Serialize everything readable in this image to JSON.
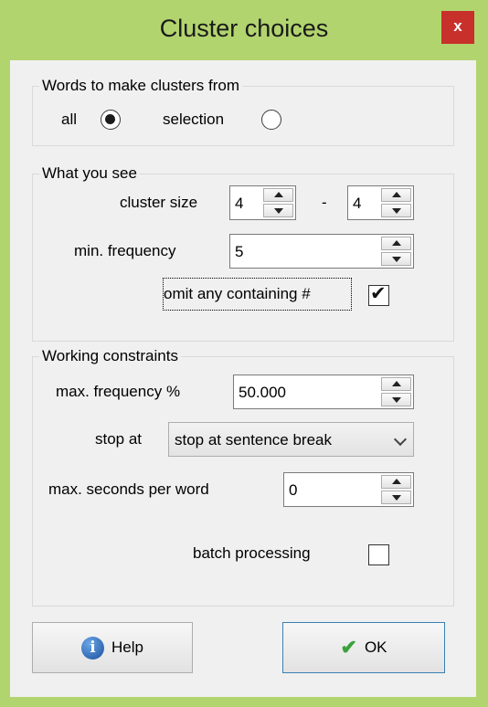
{
  "window": {
    "title": "Cluster choices",
    "close_label": "x"
  },
  "words_group": {
    "legend": "Words to make clusters from",
    "option_all": "all",
    "option_selection": "selection",
    "selected": "all"
  },
  "what_you_see": {
    "legend": "What you see",
    "cluster_size_label": "cluster size",
    "cluster_size_min": "4",
    "dash": "-",
    "cluster_size_max": "4",
    "min_frequency_label": "min. frequency",
    "min_frequency_value": "5",
    "omit_label": "omit any containing #",
    "omit_checked": true
  },
  "working": {
    "legend": "Working constraints",
    "max_freq_label": "max. frequency %",
    "max_freq_value": "50.000",
    "stop_at_label": "stop at",
    "stop_at_value": "stop at sentence break",
    "max_seconds_label": "max. seconds per word",
    "max_seconds_value": "0",
    "batch_label": "batch processing",
    "batch_checked": false
  },
  "buttons": {
    "help": "Help",
    "ok": "OK"
  },
  "colors": {
    "frame": "#b2d46f",
    "close": "#c7302b",
    "dialog": "#f0f0f0",
    "ok_border": "#3c7fb1",
    "ok_check": "#3aa23a"
  },
  "icons": {
    "help": "info-icon",
    "ok": "check-icon",
    "close": "close-icon"
  }
}
